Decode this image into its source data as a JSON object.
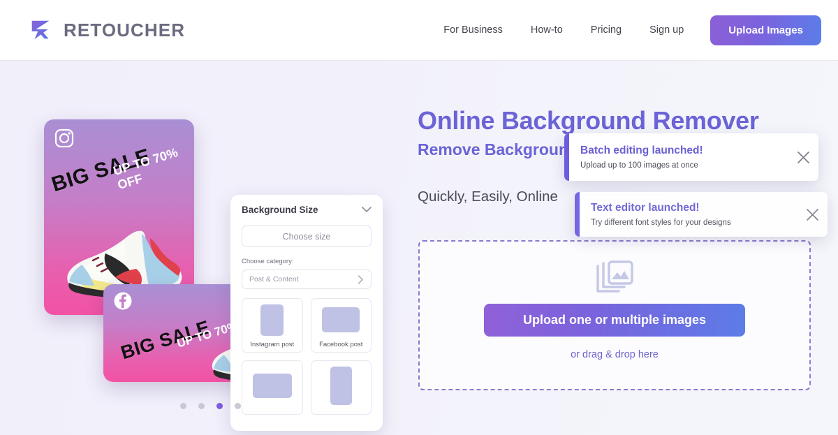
{
  "header": {
    "brand_name": "RETOUCHER",
    "logo_icon": "retoucher-logo-mark",
    "nav_links": [
      {
        "label": "For Business"
      },
      {
        "label": "How-to"
      },
      {
        "label": "Pricing"
      },
      {
        "label": "Sign up"
      }
    ],
    "cta_label": "Upload Images"
  },
  "hero": {
    "title": "Online Background Remover",
    "subtitle": "Remove Background",
    "tagline": "Quickly, Easily, Online",
    "dropzone": {
      "icon": "stacked-images-icon",
      "button_label": "Upload one or multiple images",
      "hint": "or drag & drop here"
    }
  },
  "toasts": [
    {
      "title": "Batch editing launched!",
      "message": "Upload up to 100 images at once",
      "close_icon": "close-icon"
    },
    {
      "title": "Text editor launched!",
      "message": "Try different font styles for your designs",
      "close_icon": "close-icon"
    }
  ],
  "illustration": {
    "sale_cards": [
      {
        "social_icon": "instagram-icon",
        "headline": "BIG SALE",
        "offer": "UP TO 70% OFF"
      },
      {
        "social_icon": "facebook-icon",
        "headline": "BIG SALE",
        "offer": "UP TO 70% OFF"
      }
    ],
    "panel": {
      "title": "Background Size",
      "collapse_icon": "chevron-down-icon",
      "size_placeholder": "Choose size",
      "category_label": "Choose category:",
      "category_value": "Post & Content",
      "category_icon": "chevron-right-icon",
      "presets": [
        {
          "label": "Instagram post",
          "shape": "portrait"
        },
        {
          "label": "Facebook post",
          "shape": "landscape"
        },
        {
          "label": "",
          "shape": "landscape"
        },
        {
          "label": "",
          "shape": "portrait"
        }
      ]
    },
    "carousel": {
      "total_dots": 4,
      "active_index": 2
    }
  },
  "colors": {
    "accent_purple": "#6b63d6",
    "brand_gradient_start": "#8b5fd6",
    "brand_gradient_end": "#5b7de8",
    "dot_active": "#7b5ae0",
    "dot_inactive": "#c9c9d3",
    "hero_bg": "#f2f0fb"
  }
}
